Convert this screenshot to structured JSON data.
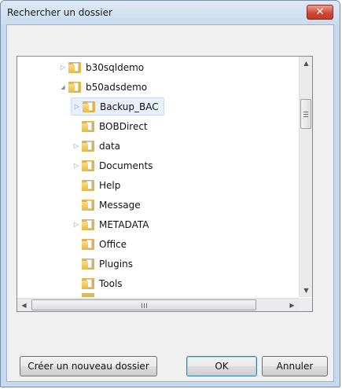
{
  "dialog": {
    "title": "Rechercher un dossier",
    "close_label": "✕"
  },
  "tree": {
    "items": [
      {
        "label": "b30sqldemo",
        "expander": "▷"
      },
      {
        "label": "b50adsdemo",
        "expander": "◢"
      },
      {
        "label": "Backup_BAC",
        "expander": "▷",
        "selected": true
      },
      {
        "label": "BOBDirect",
        "expander": ""
      },
      {
        "label": "data",
        "expander": "▷"
      },
      {
        "label": "Documents",
        "expander": "▷"
      },
      {
        "label": "Help",
        "expander": ""
      },
      {
        "label": "Message",
        "expander": ""
      },
      {
        "label": "METADATA",
        "expander": "▷"
      },
      {
        "label": "Office",
        "expander": ""
      },
      {
        "label": "Plugins",
        "expander": ""
      },
      {
        "label": "Tools",
        "expander": ""
      }
    ],
    "scroll_up": "▲",
    "scroll_down": "▼",
    "scroll_left": "◀",
    "scroll_right": "▶"
  },
  "buttons": {
    "new_folder": "Créer un nouveau dossier",
    "ok": "OK",
    "cancel": "Annuler"
  },
  "colors": {
    "folder": "#e9b842",
    "selection": "#e8f1fb",
    "title_bar": "#c9dbf0",
    "close_button": "#cf4b37"
  }
}
